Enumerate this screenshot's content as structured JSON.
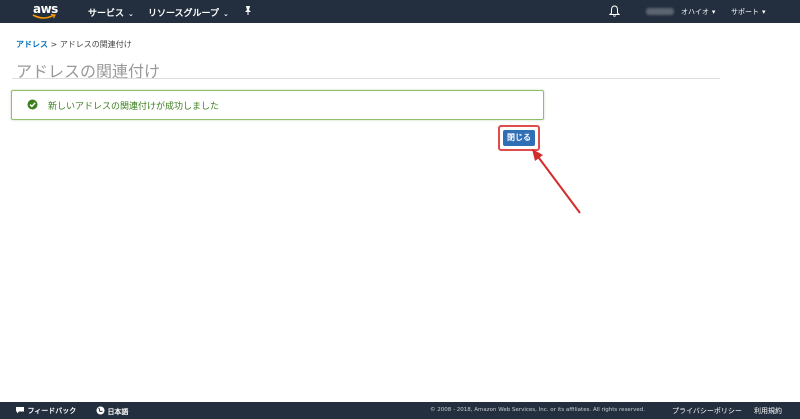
{
  "nav": {
    "logo": "aws",
    "services": "サービス",
    "resource_groups": "リソースグループ",
    "pin_icon": "pin-icon",
    "region": "オハイオ",
    "support": "サポート"
  },
  "breadcrumb": {
    "parent": "アドレス",
    "separator": ">",
    "current": "アドレスの関連付け"
  },
  "page": {
    "title": "アドレスの関連付け"
  },
  "alert": {
    "message": "新しいアドレスの関連付けが成功しました",
    "icon": "success-check-icon"
  },
  "actions": {
    "close_label": "閉じる"
  },
  "footer": {
    "feedback": "フィードバック",
    "language": "日本語",
    "copyright": "© 2008 - 2018, Amazon Web Services, Inc. or its affiliates. All rights reserved.",
    "privacy": "プライバシーポリシー",
    "terms": "利用規約"
  },
  "colors": {
    "nav_bg": "#232f3e",
    "success_green": "#3b7f1c",
    "button_blue": "#2f6fb5",
    "highlight_red": "#e04b4b"
  }
}
